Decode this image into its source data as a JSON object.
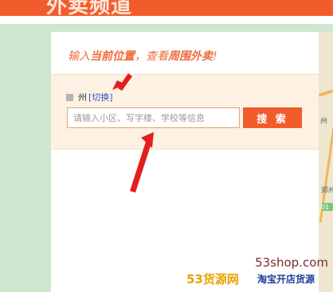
{
  "header": {
    "banner_title": "外卖频道",
    "brand_color": "#f25c2c"
  },
  "panel": {
    "slogan_prefix": "输入",
    "slogan_bold_1": "当前位置",
    "slogan_middle": "，查看",
    "slogan_bold_2": "周围外卖",
    "slogan_suffix": "!"
  },
  "location": {
    "city": "州",
    "switch_label": "[切换]"
  },
  "search": {
    "placeholder": "请输入小区、写字楼、学校等信息",
    "button_label": "搜 索"
  },
  "map": {
    "label_1": "郑州",
    "label_2": "01",
    "label_3": "州"
  },
  "watermark": {
    "domain": "53shop.com",
    "brand": "53货源网",
    "tagline": "淘宝开店货源"
  },
  "icons": {
    "city_marker": "square-icon",
    "annotation": "red-arrow-icon"
  }
}
